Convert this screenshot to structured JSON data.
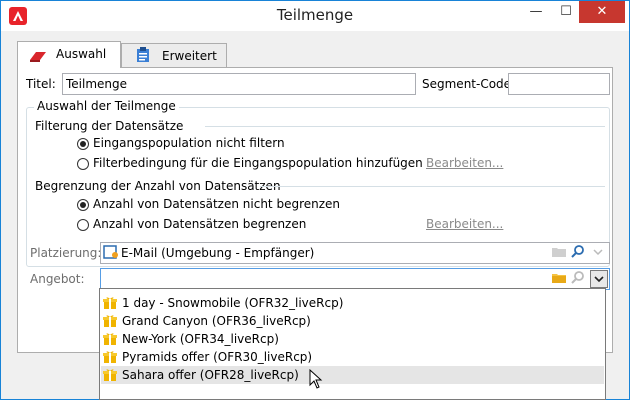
{
  "window": {
    "title": "Teilmenge",
    "close_glyph": "✕",
    "min_glyph": "—",
    "max_glyph": "☐"
  },
  "tabs": [
    {
      "label": "Auswahl",
      "icon": "eraser-icon"
    },
    {
      "label": "Erweitert",
      "icon": "clipboard-icon"
    }
  ],
  "form": {
    "title_label": "Titel:",
    "title_value": "Teilmenge",
    "segment_label": "Segment-Code:",
    "segment_value": "",
    "group_title": "Auswahl der Teilmenge",
    "filter_section": "Filterung der Datensätze",
    "filter_options": [
      {
        "label": "Eingangspopulation nicht filtern",
        "selected": true
      },
      {
        "label": "Filterbedingung für die Eingangspopulation hinzufügen",
        "selected": false
      }
    ],
    "filter_edit_link": "Bearbeiten...",
    "limit_section": "Begrenzung der Anzahl von Datensätzen",
    "limit_options": [
      {
        "label": "Anzahl von Datensätzen nicht begrenzen",
        "selected": true
      },
      {
        "label": "Anzahl von Datensätzen begrenzen",
        "selected": false
      }
    ],
    "limit_edit_link": "Bearbeiten...",
    "placement_label": "Platzierung:",
    "placement_value": "E-Mail (Umgebung - Empfänger)",
    "offer_label": "Angebot:",
    "offer_value": ""
  },
  "dropdown": {
    "items": [
      {
        "label": "1 day - Snowmobile (OFR32_liveRcp)",
        "hover": false
      },
      {
        "label": "Grand Canyon (OFR36_liveRcp)",
        "hover": false
      },
      {
        "label": "New-York (OFR34_liveRcp)",
        "hover": false
      },
      {
        "label": "Pyramids offer (OFR30_liveRcp)",
        "hover": false
      },
      {
        "label": "Sahara offer (OFR28_liveRcp)",
        "hover": true
      }
    ],
    "item_icon": "gift-icon"
  },
  "colors": {
    "accent": "#1883d7",
    "close": "#c7372f",
    "app_icon": "#e8232a",
    "gift": "#f0b400",
    "folder": "#f5c342",
    "search": "#2b6cb0"
  }
}
